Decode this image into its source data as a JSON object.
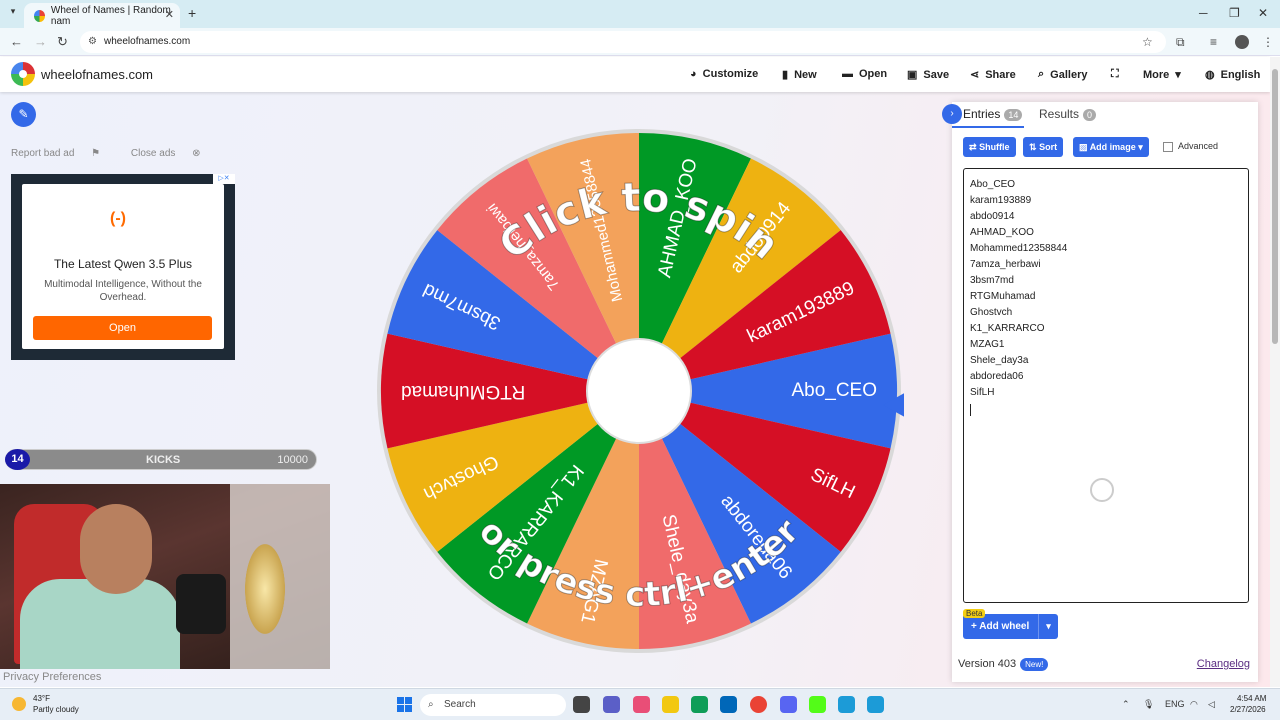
{
  "browser": {
    "tab_title": "Wheel of Names | Random nam",
    "url": "wheelofnames.com"
  },
  "site": {
    "name": "wheelofnames.com",
    "menu": {
      "customize": "Customize",
      "new": "New",
      "open": "Open",
      "save": "Save",
      "share": "Share",
      "gallery": "Gallery",
      "more": "More",
      "language": "English"
    }
  },
  "ad": {
    "report": "Report bad ad",
    "close": "Close ads",
    "logo": "(-)",
    "title": "The Latest Qwen 3.5 Plus",
    "subtitle": "Multimodal Intelligence, Without the Overhead.",
    "button": "Open"
  },
  "kicks": {
    "count": "14",
    "label": "KICKS",
    "goal": "10000"
  },
  "privacy": "Privacy Preferences",
  "wheel": {
    "overlay_top": "Click to spin",
    "overlay_bottom": "or press ctrl+enter",
    "colors": [
      "#3369e8",
      "#d50f25",
      "#eeb211",
      "#009925"
    ],
    "segments": [
      {
        "label": "Abo_CEO",
        "color": "#3369e8"
      },
      {
        "label": "SifLH",
        "color": "#d50f25"
      },
      {
        "label": "abdoreda06",
        "color": "#3369e8"
      },
      {
        "label": "Shele_day3a",
        "color": "#f06b6b"
      },
      {
        "label": "MZAG1",
        "color": "#f3a25b"
      },
      {
        "label": "K1_KARRARCO",
        "color": "#009925"
      },
      {
        "label": "Ghostvch",
        "color": "#eeb211"
      },
      {
        "label": "RTGMuhamad",
        "color": "#d50f25"
      },
      {
        "label": "3bsm7md",
        "color": "#3369e8"
      },
      {
        "label": "7amza_herbawi",
        "color": "#f06b6b"
      },
      {
        "label": "Mohammed12358844",
        "color": "#f3a25b"
      },
      {
        "label": "AHMAD_KOO",
        "color": "#009925"
      },
      {
        "label": "abdo0914",
        "color": "#eeb211"
      },
      {
        "label": "karam193889",
        "color": "#d50f25"
      }
    ]
  },
  "panel": {
    "tab_entries": "Entries",
    "entries_count": "14",
    "tab_results": "Results",
    "results_count": "0",
    "shuffle": "Shuffle",
    "sort": "Sort",
    "add_image": "Add image",
    "advanced": "Advanced",
    "entries": [
      "Abo_CEO",
      "karam193889",
      "abdo0914",
      "AHMAD_KOO",
      "Mohammed12358844",
      "7amza_herbawi",
      "3bsm7md",
      "RTGMuhamad",
      "Ghostvch",
      "K1_KARRARCO",
      "MZAG1",
      "Shele_day3a",
      "abdoreda06",
      "SifLH"
    ],
    "beta": "Beta",
    "add_wheel": "Add wheel",
    "version": "Version 403",
    "new_badge": "New!",
    "changelog": "Changelog"
  },
  "taskbar": {
    "temp": "43°F",
    "weather": "Partly cloudy",
    "search": "Search",
    "lang": "ENG",
    "time": "4:54 AM",
    "date": "2/27/2026"
  }
}
